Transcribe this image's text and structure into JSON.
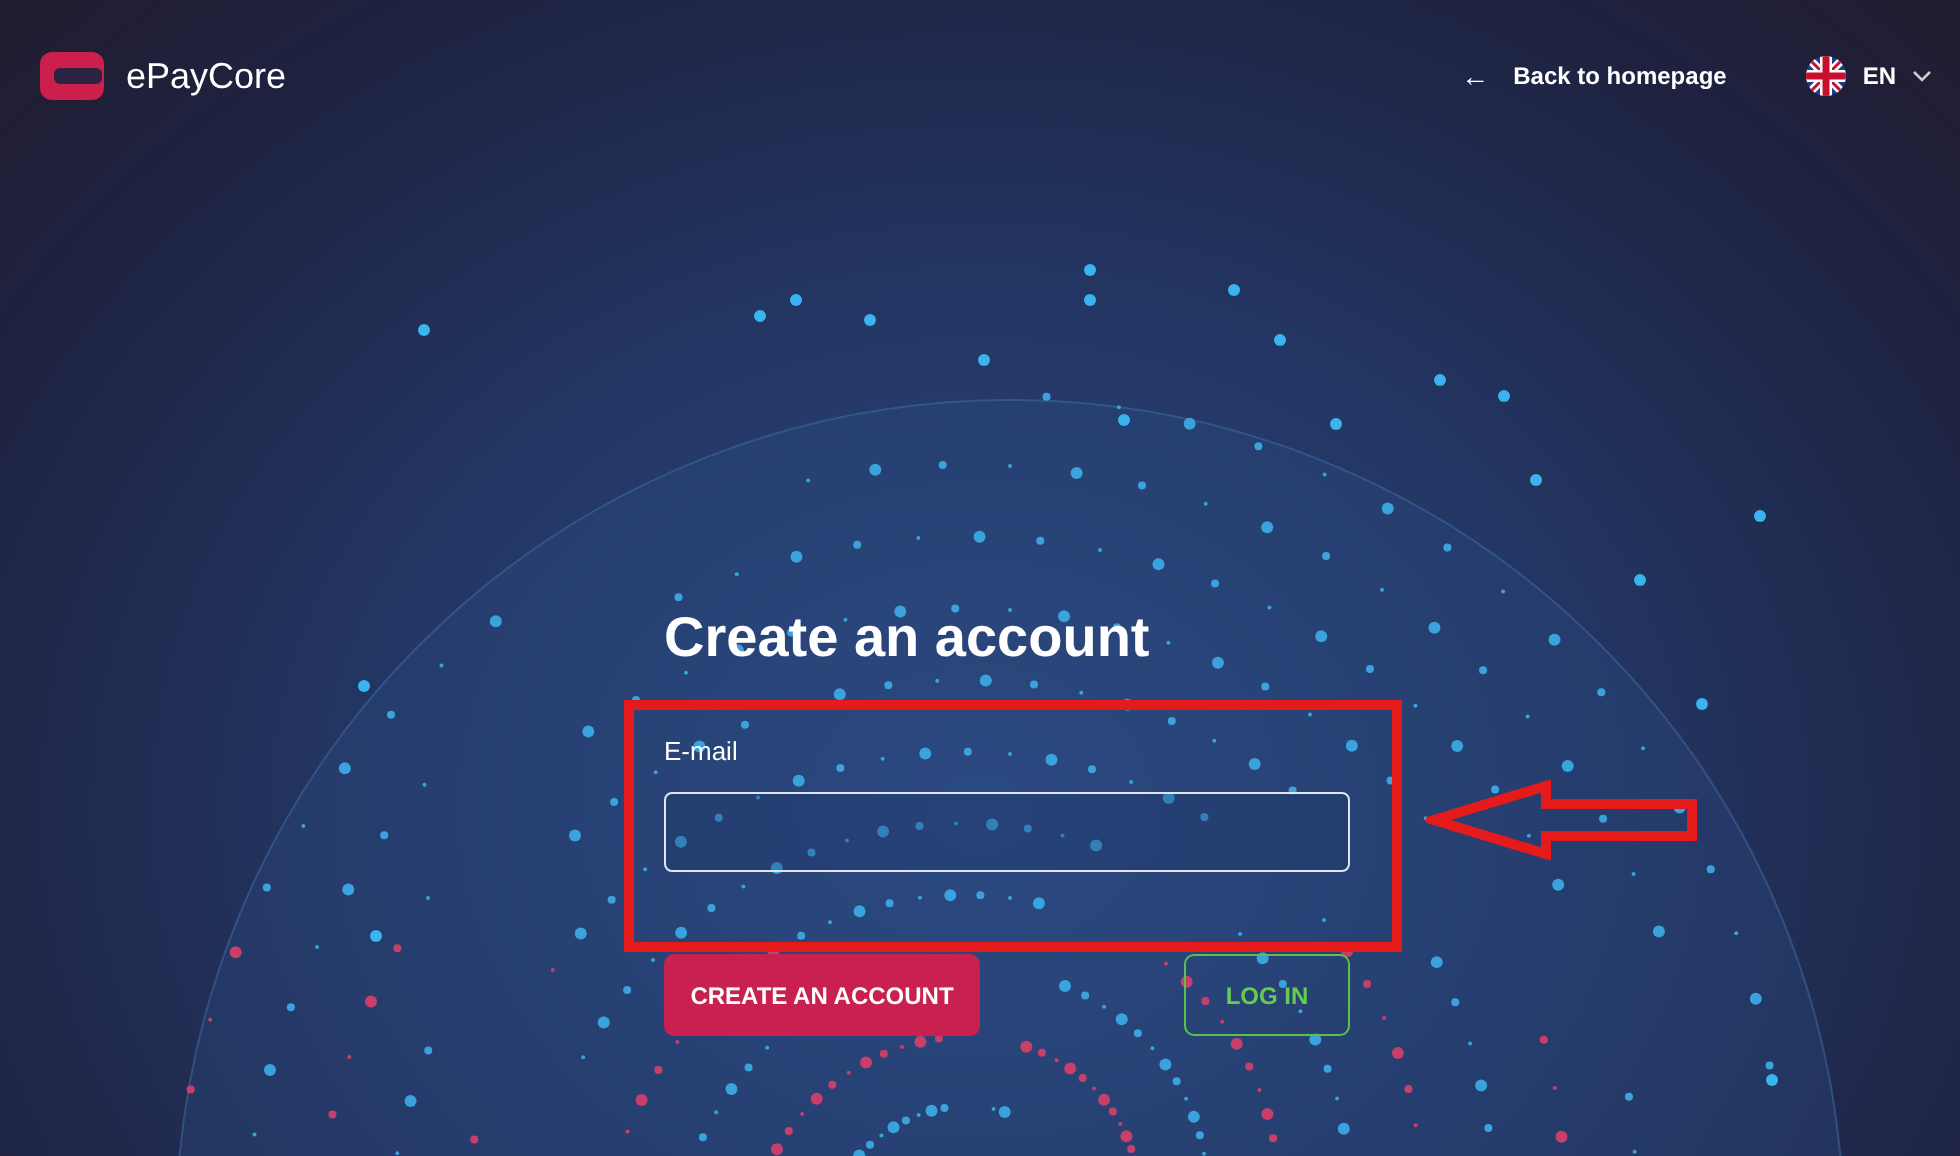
{
  "header": {
    "logo_text": "ePayCore",
    "back_link": {
      "arrow": "←",
      "label": "Back to homepage"
    },
    "language": "EN"
  },
  "form": {
    "title": "Create an account",
    "email_label": "E-mail",
    "buttons": [
      {
        "label": "CREATE AN ACCOUNT",
        "kind": "primary"
      },
      {
        "label": "LOG IN",
        "kind": "outline"
      }
    ]
  }
}
